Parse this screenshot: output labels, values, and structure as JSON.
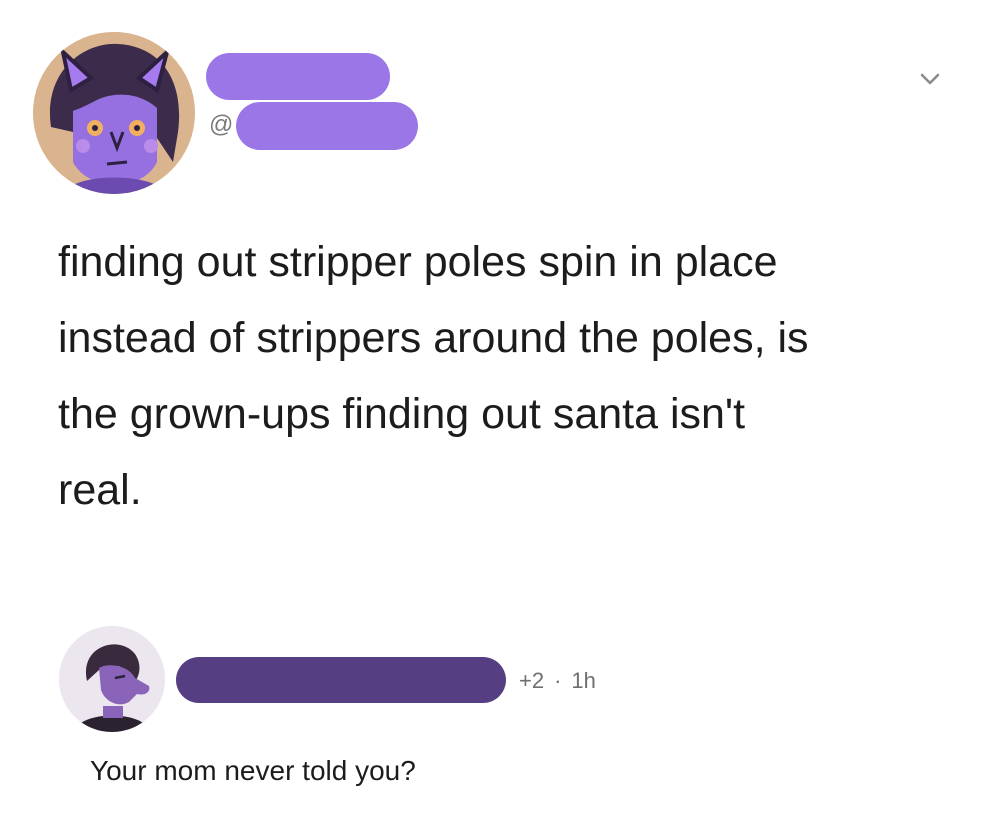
{
  "post": {
    "at_symbol": "@",
    "body_lines": [
      "finding out stripper poles spin in place",
      "instead of strippers around the poles, is",
      "the grown-ups finding out santa isn't",
      "real."
    ]
  },
  "reply": {
    "count": "+2",
    "separator": "·",
    "time": "1h",
    "text": "Your mom never told you?"
  },
  "colors": {
    "redaction_post": "#9b76e6",
    "redaction_reply": "#553f82",
    "meta_text": "#6f6f6f"
  },
  "icons": {
    "menu": "chevron-down-icon"
  }
}
